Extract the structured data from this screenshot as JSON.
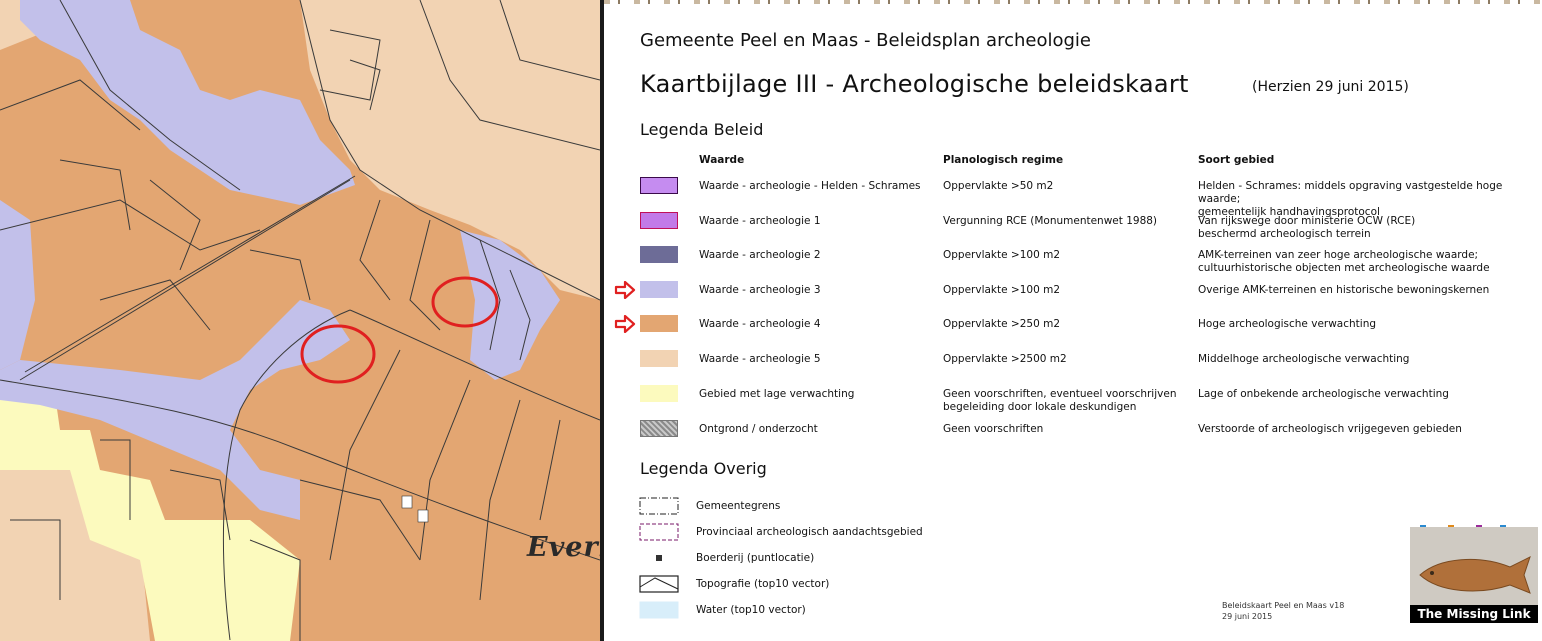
{
  "header": {
    "title": "Gemeente Peel en Maas - Beleidsplan archeologie",
    "subtitle": "Kaartbijlage III - Archeologische beleidskaart",
    "revision": "(Herzien 29 juni 2015)"
  },
  "legend_beleid": {
    "heading": "Legenda Beleid",
    "columns": {
      "waarde": "Waarde",
      "regime": "Planologisch regime",
      "soort": "Soort gebied"
    },
    "rows": [
      {
        "color": "#c58cf0",
        "border": "#3a0a4a",
        "waarde": "Waarde - archeologie - Helden - Schrames",
        "regime": "Oppervlakte >50 m2",
        "soort": "Helden - Schrames: middels opgraving vastgestelde hoge waarde;\ngemeentelijk handhavingsprotocol"
      },
      {
        "color": "#c27ae8",
        "border": "#c0105a",
        "waarde": "Waarde - archeologie 1",
        "regime": "Vergunning RCE (Monumentenwet 1988)",
        "soort": "Van rijkswege door ministerie OCW (RCE)\nbeschermd archeologisch terrein"
      },
      {
        "color": "#6d6c97",
        "border": "#6d6c97",
        "waarde": "Waarde - archeologie 2",
        "regime": "Oppervlakte >100 m2",
        "soort": "AMK-terreinen van zeer hoge archeologische waarde;\ncultuurhistorische objecten met archeologische waarde"
      },
      {
        "color": "#c2c0ea",
        "border": "#c2c0ea",
        "waarde": "Waarde - archeologie 3",
        "regime": "Oppervlakte >100 m2",
        "soort": "Overige AMK-terreinen en historische bewoningskernen",
        "arrow": true
      },
      {
        "color": "#e3a672",
        "border": "#e3a672",
        "waarde": "Waarde - archeologie 4",
        "regime": "Oppervlakte >250 m2",
        "soort": "Hoge archeologische verwachting",
        "arrow": true
      },
      {
        "color": "#f2d3b3",
        "border": "#f2d3b3",
        "waarde": "Waarde - archeologie 5",
        "regime": "Oppervlakte >2500 m2",
        "soort": "Middelhoge archeologische verwachting"
      },
      {
        "color": "#fcfabe",
        "border": "#fcfabe",
        "waarde": "Gebied met lage verwachting",
        "regime": "Geen voorschriften, eventueel voorschrijven\nbegeleiding door lokale deskundigen",
        "soort": "Lage of onbekende archeologische verwachting"
      },
      {
        "color": "#a8a8a8",
        "border": "#777777",
        "pattern": "crosshatch",
        "waarde": "Ontgrond / onderzocht",
        "regime": "Geen voorschriften",
        "soort": "Verstoorde of archeologisch vrijgegeven gebieden"
      }
    ]
  },
  "legend_overig": {
    "heading": "Legenda Overig",
    "items": [
      {
        "label": "Gemeentegrens",
        "icon": "dashdot-boundary"
      },
      {
        "label": "Provinciaal archeologisch aandachtsgebied",
        "icon": "dashed-purple-boundary"
      },
      {
        "label": "Boerderij (puntlocatie)",
        "icon": "farm-point"
      },
      {
        "label": "Topografie (top10 vector)",
        "icon": "topography-lines"
      },
      {
        "label": "Water (top10 vector)",
        "icon": "water-fill"
      }
    ]
  },
  "footer": {
    "text": "Beleidskaart Peel en Maas v18\n29 juni 2015"
  },
  "logo": {
    "text": "The Missing Link",
    "dot_colors": [
      "#2a8ad0",
      "#e08a1a",
      "#9a2a9a",
      "#2a8ad0"
    ]
  },
  "map": {
    "place_label": "Everl"
  }
}
